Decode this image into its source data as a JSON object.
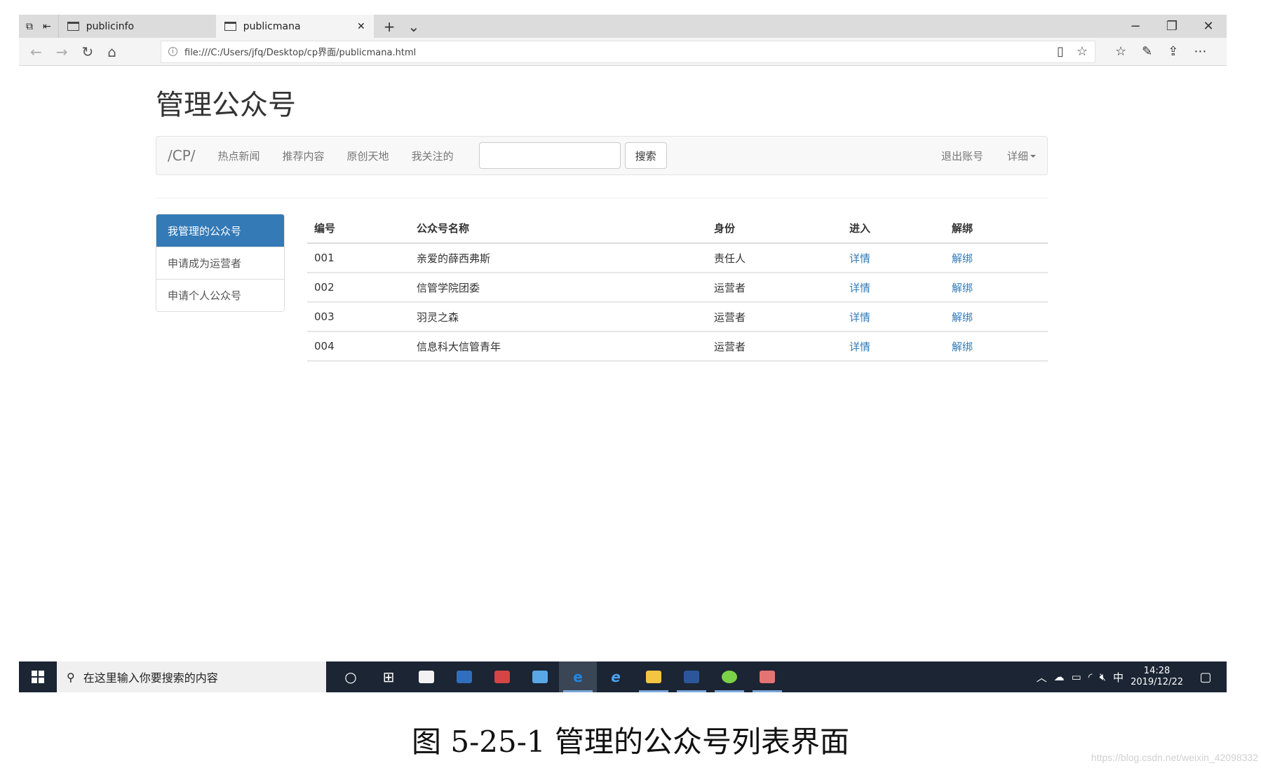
{
  "browser": {
    "tabs": [
      {
        "title": "publicinfo"
      },
      {
        "title": "publicmana"
      }
    ],
    "url": "file:///C:/Users/jfq/Desktop/cp界面/publicmana.html"
  },
  "page": {
    "title": "管理公众号",
    "navbar": {
      "brand": "/CP/",
      "links": [
        "热点新闻",
        "推荐内容",
        "原创天地",
        "我关注的"
      ],
      "search_button": "搜索",
      "search_value": "",
      "logout": "退出账号",
      "detail": "详细"
    },
    "sidebar": {
      "items": [
        {
          "label": "我管理的公众号",
          "active": true
        },
        {
          "label": "申请成为运营者",
          "active": false
        },
        {
          "label": "申请个人公众号",
          "active": false
        }
      ]
    },
    "table": {
      "headers": [
        "编号",
        "公众号名称",
        "身份",
        "进入",
        "解绑"
      ],
      "rows": [
        [
          "001",
          "亲爱的薛西弗斯",
          "责任人",
          "详情",
          "解绑"
        ],
        [
          "002",
          "信管学院团委",
          "运营者",
          "详情",
          "解绑"
        ],
        [
          "003",
          "羽灵之森",
          "运营者",
          "详情",
          "解绑"
        ],
        [
          "004",
          "信息科大信管青年",
          "运营者",
          "详情",
          "解绑"
        ]
      ]
    },
    "colors": {
      "primary": "#337ab7",
      "taskbar": "#1b2533"
    }
  },
  "taskbar": {
    "search_placeholder": "在这里输入你要搜索的内容",
    "ime": "中",
    "time": "14:28",
    "date": "2019/12/22"
  },
  "caption": "图 5-25-1 管理的公众号列表界面",
  "watermark": "https://blog.csdn.net/weixin_42098332"
}
